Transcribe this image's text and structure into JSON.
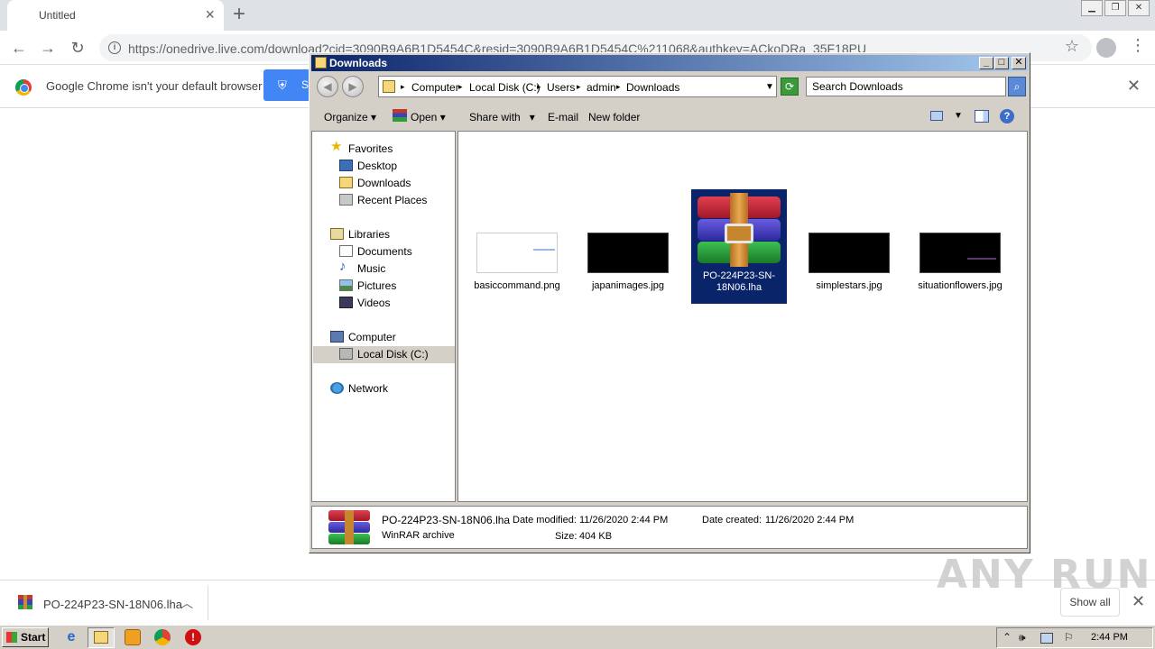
{
  "browser": {
    "tab_title": "Untitled",
    "url": "https://onedrive.live.com/download?cid=3090B9A6B1D5454C&resid=3090B9A6B1D5454C%211068&authkey=ACkoDRa_35F18PU",
    "infobar_text": "Google Chrome isn't your default browser",
    "infobar_button_initial": "S"
  },
  "explorer": {
    "title": "Downloads",
    "breadcrumbs": [
      "Computer",
      "Local Disk (C:)",
      "Users",
      "admin",
      "Downloads"
    ],
    "search_placeholder": "Search Downloads",
    "commands": {
      "organize": "Organize",
      "open": "Open",
      "share_with": "Share with",
      "email": "E-mail",
      "new_folder": "New folder"
    },
    "nav": {
      "favorites": "Favorites",
      "desktop": "Desktop",
      "downloads": "Downloads",
      "recent_places": "Recent Places",
      "libraries": "Libraries",
      "documents": "Documents",
      "music": "Music",
      "pictures": "Pictures",
      "videos": "Videos",
      "computer": "Computer",
      "local_disk": "Local Disk (C:)",
      "network": "Network"
    },
    "files": [
      {
        "name": "basiccommand.png"
      },
      {
        "name": "japanimages.jpg"
      },
      {
        "name": "PO-224P23-SN-18N06.lha",
        "selected": true
      },
      {
        "name": "simplestars.jpg"
      },
      {
        "name": "situationflowers.jpg"
      }
    ],
    "details": {
      "name": "PO-224P23-SN-18N06.lha",
      "type": "WinRAR archive",
      "date_modified_label": "Date modified:",
      "date_modified": "11/26/2020 2:44 PM",
      "date_created_label": "Date created:",
      "date_created": "11/26/2020 2:44 PM",
      "size_label": "Size:",
      "size": "404 KB"
    }
  },
  "download_shelf": {
    "filename": "PO-224P23-SN-18N06.lha",
    "show_all": "Show all"
  },
  "taskbar": {
    "start": "Start",
    "clock": "2:44 PM"
  },
  "watermark": "ANY RUN"
}
